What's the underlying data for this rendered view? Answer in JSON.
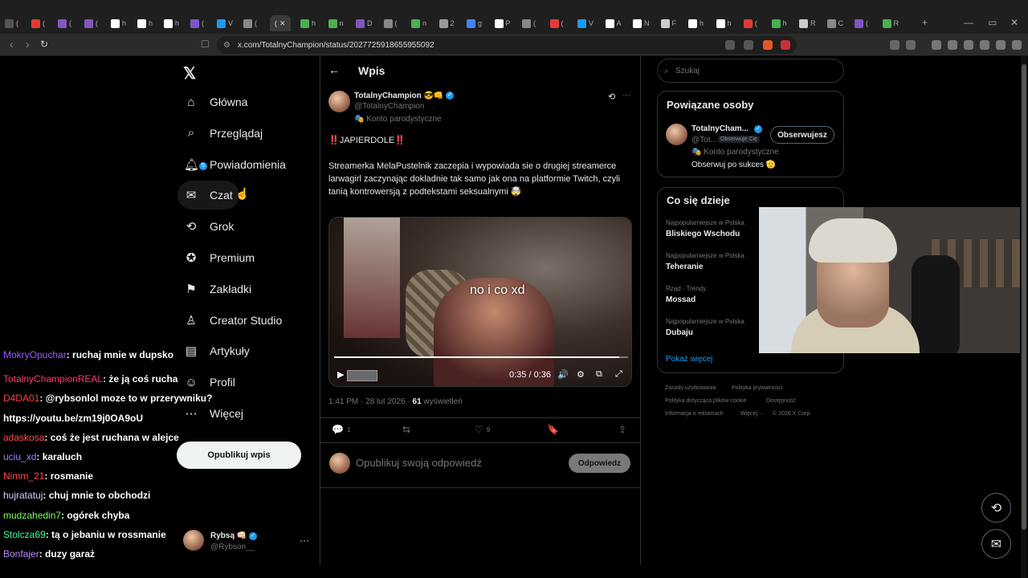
{
  "browser": {
    "tabs_left": [
      "(",
      "(",
      "(",
      "(",
      "h",
      "h",
      "h",
      "(",
      "V",
      "("
    ],
    "active_tab": "(",
    "tabs_right": [
      "h",
      "n",
      "D",
      "(",
      "n",
      "2",
      "g",
      "P",
      "(",
      "(",
      "V",
      "A",
      "N",
      "F",
      "h",
      "h",
      "(",
      "h",
      "R",
      "C",
      "(",
      "R"
    ],
    "url": "x.com/TotalnyChampion/status/2027725918655955092"
  },
  "sidebar": {
    "items": [
      {
        "label": "Główna",
        "icon": "home-icon"
      },
      {
        "label": "Przeglądaj",
        "icon": "search-icon"
      },
      {
        "label": "Powiadomienia",
        "icon": "bell-icon",
        "badge": "5"
      },
      {
        "label": "Czat",
        "icon": "mail-icon"
      },
      {
        "label": "Grok",
        "icon": "grok-icon"
      },
      {
        "label": "Premium",
        "icon": "premium-icon"
      },
      {
        "label": "Zakładki",
        "icon": "bookmark-icon"
      },
      {
        "label": "Creator Studio",
        "icon": "creator-icon"
      },
      {
        "label": "Artykuły",
        "icon": "article-icon"
      },
      {
        "label": "Profil",
        "icon": "profile-icon"
      },
      {
        "label": "Więcej",
        "icon": "more-icon"
      }
    ],
    "publish_label": "Opublikuj wpis",
    "account_name": "Rybsą 👊🏻",
    "account_handle": "@Rybson__"
  },
  "main": {
    "header_title": "Wpis",
    "tweet": {
      "author_name": "TotalnyChampion 😎👊",
      "author_handle": "@TotalnyChampion",
      "author_label": "Konto parodystyczne",
      "headline": "‼️JAPIERDOLE‼️",
      "body": "Streamerka MelaPustelnik zaczepia i wypowiada sie o drugiej streamerce larwagirl zaczynając dokladnie tak samo jak ona na platformie Twitch, czyli tanią kontrowersją z podtekstami seksualnymi 🤯",
      "video_caption": "no i co xd",
      "video_time": "0:35 / 0:36",
      "video_progress": 0.97,
      "timestamp": "1:41 PM · 28 lut 2026 · ",
      "views_count": "61",
      "views_label": " wyświetleń",
      "reply_count": "1",
      "retweet_count": "",
      "like_count": "9"
    },
    "reply_placeholder": "Opublikuj swoją odpowiedź",
    "reply_button": "Odpowiedz"
  },
  "right": {
    "search_placeholder": "Szukaj",
    "related_title": "Powiązane osoby",
    "related_person": {
      "name": "TotalnyCham...",
      "handle": "@Tot...",
      "follows_you": "Obserwuje Cię",
      "label": "Konto parodystyczne",
      "bio": "Obserwuj po sukces 🫡",
      "follow_label": "Obserwujesz"
    },
    "trends_title": "Co się dzieje",
    "trends": [
      {
        "category": "Najpopularniejsze w Polska",
        "name": "Bliskiego Wschodu"
      },
      {
        "category": "Najpopularniejsze w Polska",
        "name": "Teheranie"
      },
      {
        "category": "Rząd · Trendy",
        "name": "Mossad"
      },
      {
        "category": "Najpopularniejsze w Polska",
        "name": "Dubaju"
      }
    ],
    "show_more": "Pokaż więcej",
    "footer": [
      "Zasady użytkowania",
      "Polityka prywatności",
      "Polityka dotycząca plików cookie",
      "Dostępność",
      "Informacja o reklamach",
      "Więcej ···",
      "© 2026 X Corp."
    ]
  },
  "chat": [
    {
      "user": "MokryOpuchar",
      "msg": ": ruchaj mnie w dupsko",
      "color": "#9b59ff"
    },
    {
      "user": "TotalnyChampionREAL",
      "msg": ": że ją coś rucha",
      "color": "#ff3b6b"
    },
    {
      "user": "D4DA01",
      "msg": ": @rybsonlol moze to w przerywniku?",
      "color": "#ff4040"
    },
    {
      "user": "",
      "msg": "https://youtu.be/zm19j0OA9oU",
      "color": "#fff"
    },
    {
      "user": "adaskosa",
      "msg": ": coś że jest ruchana w alejce",
      "color": "#ff5050"
    },
    {
      "user": "uciu_xd",
      "msg": ": karaluch",
      "color": "#a77bff"
    },
    {
      "user": "Nimm_21",
      "msg": ": rosmanie",
      "color": "#ff4a4a"
    },
    {
      "user": "hujratatuj",
      "msg": ": chuj mnie to obchodzi",
      "color": "#d0d0ff"
    },
    {
      "user": "mudzahedin7",
      "msg": ": ogórek chyba",
      "color": "#7bff5a"
    },
    {
      "user": "Stolcza69",
      "msg": ": tą o jebaniu w rossmanie",
      "color": "#40ff9a"
    },
    {
      "user": "Bonfajer",
      "msg": ": duzy garaż",
      "color": "#c08cff"
    }
  ]
}
